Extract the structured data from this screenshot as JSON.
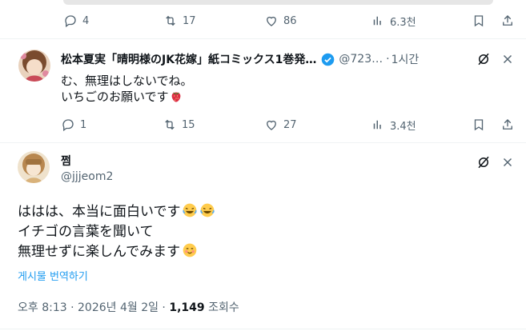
{
  "top_tweet": {
    "replies": "4",
    "retweets": "17",
    "likes": "86",
    "views": "6.3천"
  },
  "reply_tweet": {
    "display_name": "松本夏実「晴明様のJK花嫁」紙コミックス1巻発…",
    "handle": "@723…",
    "separator": "·",
    "time": "1시간",
    "lines": [
      "む、無理はしないでね。",
      "いちごのお願いです"
    ],
    "replies": "1",
    "retweets": "15",
    "likes": "27",
    "views": "3.4천"
  },
  "main_tweet": {
    "display_name": "쩜",
    "handle": "@jjjeom2",
    "lines": [
      "ははは、本当に面白いです",
      "イチゴの言葉を聞いて",
      "無理せずに楽しんでみます"
    ],
    "translate_label": "게시물 번역하기",
    "timestamp": "오후 8:13 · 2026년 4월 2일 · ",
    "view_count": "1,149",
    "view_label": " 조회수"
  },
  "colors": {
    "text": "#0f1419",
    "muted": "#536471",
    "accent": "#1d9bf0",
    "verified": "#1d9bf0",
    "divider": "#eff3f4"
  },
  "icons": [
    "reply-icon",
    "retweet-icon",
    "like-icon",
    "views-icon",
    "bookmark-icon",
    "share-icon",
    "grok-icon",
    "more-icon",
    "verified-badge-icon",
    "strawberry-emoji",
    "laughing-emoji",
    "smiling-emoji"
  ]
}
